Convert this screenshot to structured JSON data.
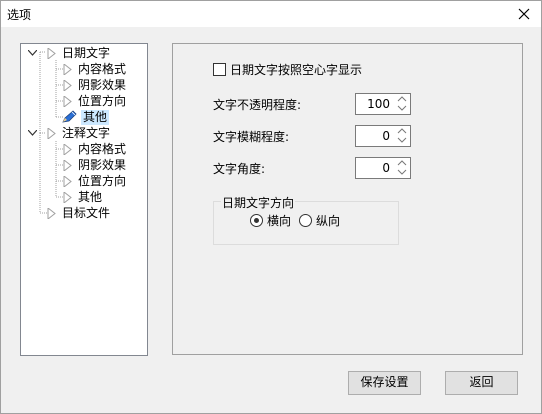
{
  "window": {
    "title": "选项"
  },
  "tree": {
    "items": [
      {
        "label": "日期文字"
      },
      {
        "label": "内容格式"
      },
      {
        "label": "阴影效果"
      },
      {
        "label": "位置方向"
      },
      {
        "label": "其他"
      },
      {
        "label": "注释文字"
      },
      {
        "label": "内容格式"
      },
      {
        "label": "阴影效果"
      },
      {
        "label": "位置方向"
      },
      {
        "label": "其他"
      },
      {
        "label": "目标文件"
      }
    ]
  },
  "settings": {
    "hollow_label": "日期文字按照空心字显示",
    "opacity_label": "文字不透明程度:",
    "opacity_value": "100",
    "blur_label": "文字模糊程度:",
    "blur_value": "0",
    "angle_label": "文字角度:",
    "angle_value": "0",
    "direction_group": "日期文字方向",
    "horizontal_label": "横向",
    "vertical_label": "纵向"
  },
  "footer": {
    "save_label": "保存设置",
    "back_label": "返回"
  }
}
